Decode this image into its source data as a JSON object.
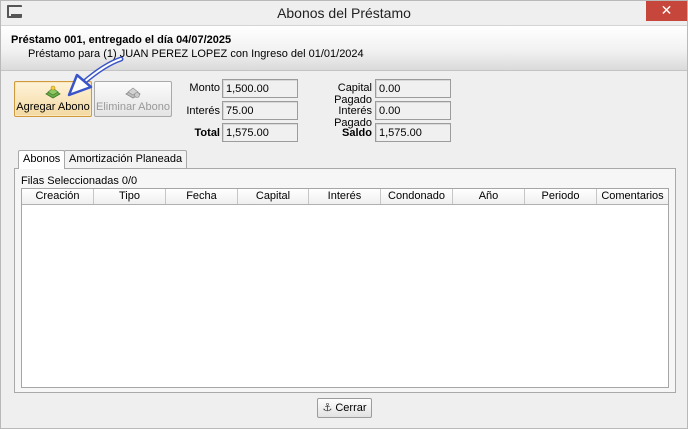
{
  "window": {
    "title": "Abonos del Préstamo",
    "close_symbol": "✕"
  },
  "header": {
    "title": "Préstamo 001, entregado el día 04/07/2025",
    "subtitle": "Préstamo para (1) JUAN PEREZ LOPEZ con Ingreso del 01/01/2024"
  },
  "toolbar": {
    "add_label": "Agregar Abono",
    "delete_label": "Eliminar Abono"
  },
  "summary": {
    "monto_label": "Monto",
    "monto_value": "1,500.00",
    "interes_label": "Interés",
    "interes_value": "75.00",
    "total_label": "Total",
    "total_value": "1,575.00",
    "capital_pagado_label": "Capital Pagado",
    "capital_pagado_value": "0.00",
    "interes_pagado_label": "Interés Pagado",
    "interes_pagado_value": "0.00",
    "saldo_label": "Saldo",
    "saldo_value": "1,575.00"
  },
  "tabs": [
    {
      "label": "Abonos",
      "active": true
    },
    {
      "label": "Amortización Planeada",
      "active": false
    }
  ],
  "grid": {
    "rows_selected": "Filas Seleccionadas 0/0",
    "columns": [
      "Creación",
      "Tipo",
      "Fecha",
      "Capital",
      "Interés",
      "Condonado",
      "Año",
      "Periodo",
      "Comentarios"
    ],
    "rows": []
  },
  "footer": {
    "close_label": "Cerrar",
    "close_icon_glyph": "⚓"
  },
  "icons": {
    "app": "window-icon",
    "add": "money-add-icon",
    "delete": "money-delete-icon",
    "close_button": "anchor-icon"
  }
}
